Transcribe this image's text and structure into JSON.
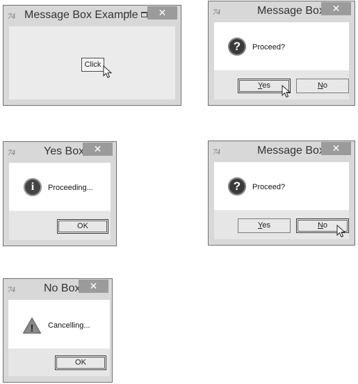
{
  "app_icon_label": "74",
  "window1": {
    "title": "Message Box Example",
    "click_button": "Click",
    "close_glyph": "✕",
    "min_glyph": "–"
  },
  "window2": {
    "title": "Message Box",
    "message": "Proceed?",
    "icon_glyph": "?",
    "yes_underline": "Y",
    "yes_rest": "es",
    "no_underline": "N",
    "no_rest": "o",
    "close_glyph": "✕",
    "focused_button": "yes"
  },
  "window3": {
    "title": "Yes Box",
    "message": "Proceeding...",
    "icon_glyph": "i",
    "ok_label": "OK",
    "close_glyph": "✕"
  },
  "window4": {
    "title": "Message Box",
    "message": "Proceed?",
    "icon_glyph": "?",
    "yes_underline": "Y",
    "yes_rest": "es",
    "no_underline": "N",
    "no_rest": "o",
    "close_glyph": "✕",
    "focused_button": "no"
  },
  "window5": {
    "title": "No Box",
    "message": "Cancelling...",
    "icon_glyph": "!",
    "ok_label": "OK",
    "close_glyph": "✕"
  }
}
